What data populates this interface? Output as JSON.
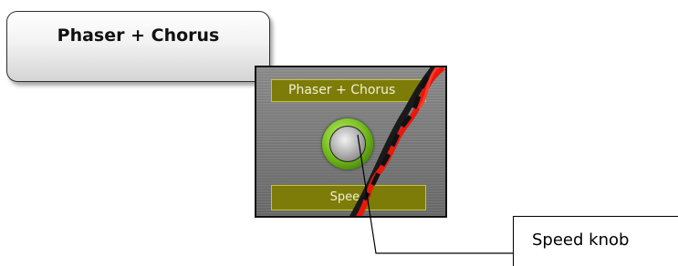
{
  "callout": {
    "title": "Phaser + Chorus"
  },
  "module": {
    "title_plate": "Phaser + Chorus",
    "knob_caption": "Speed"
  },
  "annotation": {
    "label": "Speed knob"
  },
  "colors": {
    "plate": "#7d7c09",
    "plate_text": "#f1f0d2",
    "knob_ring": "#6cb517",
    "cable_red": "#e8190c",
    "cable_black": "#1a1a1a"
  }
}
